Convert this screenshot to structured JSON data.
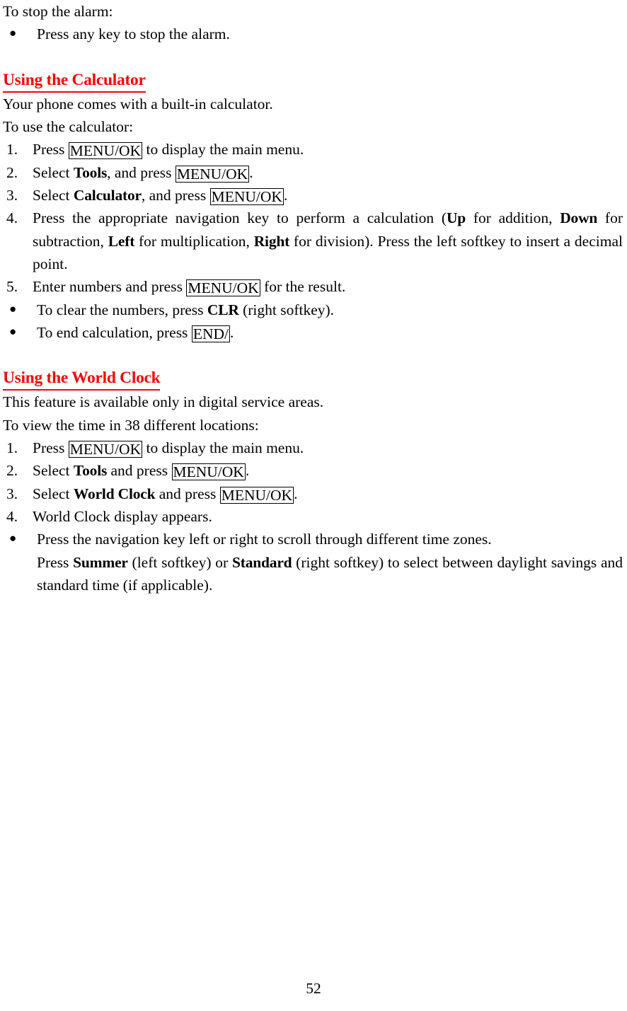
{
  "document": {
    "page_number": "52",
    "accent_color": "#ff0000",
    "text_color": "#000000"
  },
  "alarm_section": {
    "intro": "To stop the alarm:",
    "bullets": [
      {
        "icon": "bullet-dot",
        "text": "Press any key to stop the alarm."
      }
    ]
  },
  "calculator_section": {
    "heading": "Using the Calculator",
    "intro_1": "Your phone comes with a built-in calculator.",
    "intro_2": "To use the calculator:",
    "steps": [
      {
        "number": "1.",
        "pre": "Press ",
        "key": "MENU/OK",
        "post": " to display the main menu."
      },
      {
        "number": "2.",
        "pre": "Select ",
        "bold": "Tools",
        "mid": ", and press ",
        "key": "MENU/OK",
        "post": "."
      },
      {
        "number": "3.",
        "pre": "Select ",
        "bold": "Calculator",
        "mid": ", and press ",
        "key": "MENU/OK",
        "post": "."
      },
      {
        "number": "4.",
        "seg_1": "Press the appropriate navigation key to perform a calculation (",
        "bold_1": "Up",
        "seg_2": " for addition, ",
        "bold_2": "Down",
        "seg_3": " for subtraction, ",
        "bold_3": "Left",
        "seg_4": " for multiplication, ",
        "bold_4": "Right",
        "seg_5": " for division).   Press the left softkey to insert a decimal point."
      },
      {
        "number": "5.",
        "pre": "Enter numbers and press ",
        "key": "MENU/OK",
        "post": " for the result."
      }
    ],
    "bullets": [
      {
        "icon": "bullet-dot",
        "pre": "To clear the numbers, press ",
        "bold": "CLR",
        "post": " (right softkey)."
      },
      {
        "icon": "bullet-dot",
        "pre": "To end calculation, press ",
        "key": "END/",
        "post": "."
      }
    ]
  },
  "world_clock_section": {
    "heading": "Using the World Clock",
    "intro_1": "This feature is available only in digital service areas.",
    "intro_2": "To view the time in 38 different locations:",
    "steps": [
      {
        "number": "1.",
        "pre": "Press ",
        "key": "MENU/OK",
        "post": " to display the main menu."
      },
      {
        "number": "2.",
        "pre": "Select ",
        "bold": "Tools",
        "mid": " and press ",
        "key": "MENU/OK",
        "post": "."
      },
      {
        "number": "3.",
        "pre": "Select ",
        "bold": "World Clock",
        "mid": " and press ",
        "key": "MENU/OK",
        "post": "."
      },
      {
        "number": "4.",
        "plain": "World Clock display appears."
      }
    ],
    "bullets": [
      {
        "icon": "bullet-dot",
        "line_1": "Press the navigation key left or right to scroll through different time zones.",
        "line_2_pre": "Press ",
        "line_2_bold_1": "Summer",
        "line_2_mid_1": " (left softkey) or ",
        "line_2_bold_2": "Standard",
        "line_2_post": " (right softkey) to select between daylight savings and standard time (if applicable)."
      }
    ]
  }
}
